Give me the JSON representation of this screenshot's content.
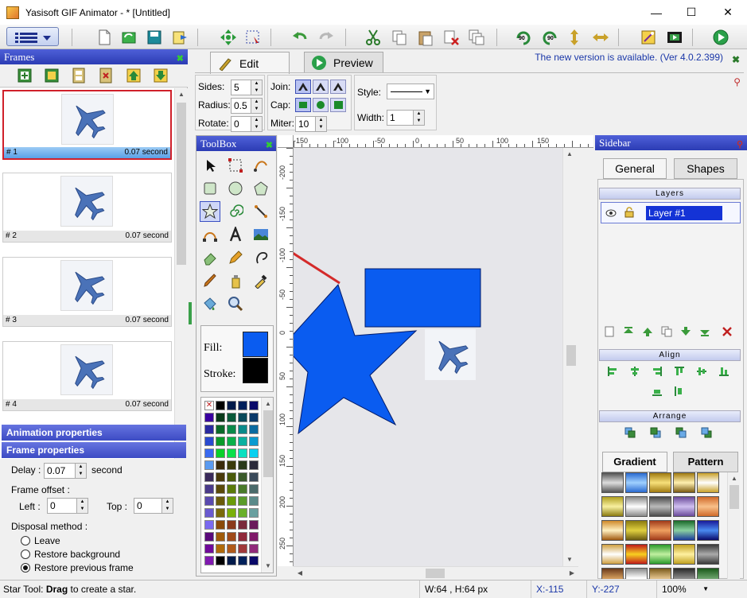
{
  "window": {
    "title": "Yasisoft GIF Animator - * [Untitled]",
    "minimize_glyph": "—",
    "maximize_glyph": "☐",
    "close_glyph": "✕"
  },
  "frames_panel": {
    "title": "Frames",
    "close_glyph": "✖",
    "frames": [
      {
        "number": "# 1",
        "duration": "0.07 second"
      },
      {
        "number": "# 2",
        "duration": "0.07 second"
      },
      {
        "number": "# 3",
        "duration": "0.07 second"
      },
      {
        "number": "# 4",
        "duration": "0.07 second"
      }
    ]
  },
  "animation_properties": {
    "title": "Animation properties"
  },
  "frame_properties": {
    "title": "Frame properties",
    "delay_label": "Delay :",
    "delay_value": "0.07",
    "delay_unit": "second",
    "offset_label": "Frame offset :",
    "left_label": "Left :",
    "left_value": "0",
    "top_label": "Top :",
    "top_value": "0",
    "disposal_label": "Disposal method :",
    "disposal_options": [
      "Leave",
      "Restore background",
      "Restore previous frame"
    ],
    "disposal_selected": "Restore previous frame"
  },
  "editor_tabs": {
    "edit": "Edit",
    "preview": "Preview",
    "notice": "The new version is available. (Ver 4.0.2.399)",
    "notice_close": "✖"
  },
  "shape_props": {
    "sides_label": "Sides:",
    "sides_value": "5",
    "radius_label": "Radius:",
    "radius_value": "0.5",
    "rotate_label": "Rotate:",
    "rotate_value": "0",
    "join_label": "Join:",
    "cap_label": "Cap:",
    "miter_label": "Miter:",
    "miter_value": "10",
    "style_label": "Style:",
    "width_label": "Width:",
    "width_value": "1"
  },
  "toolbox": {
    "title": "ToolBox",
    "fill_label": "Fill:",
    "stroke_label": "Stroke:",
    "fill_color": "#0a5cf0",
    "stroke_color": "#000000"
  },
  "rulers": {
    "h_labels": [
      "-150",
      "-100",
      "-50",
      "0",
      "50",
      "100",
      "150"
    ],
    "v_labels": [
      "-200",
      "-150",
      "-100",
      "-50",
      "0",
      "50",
      "100",
      "150",
      "200",
      "250"
    ]
  },
  "sidebar": {
    "title": "Sidebar",
    "tab_general": "General",
    "tab_shapes": "Shapes",
    "layers_title": "Layers",
    "layer_name": "Layer #1",
    "align_title": "Align",
    "arrange_title": "Arrange",
    "tab_gradient": "Gradient",
    "tab_pattern": "Pattern"
  },
  "status": {
    "hint_prefix": "Star Tool: ",
    "hint_bold": "Drag",
    "hint_suffix": " to create a star.",
    "size": "W:64 , H:64 px",
    "x": "X:-115",
    "y": "Y:-227",
    "zoom": "100%"
  },
  "colors": {
    "shape_blue": "#0a5cf0",
    "panel_title": "#2b3cb4",
    "annotation_arrow": "#d42a2a"
  }
}
